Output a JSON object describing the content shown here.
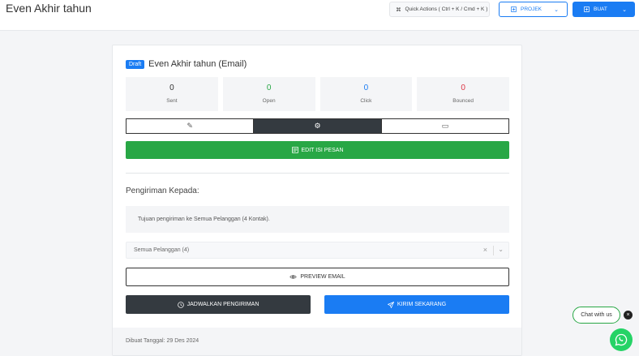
{
  "header": {
    "title": "Even Akhir tahun",
    "quick_actions_label": "Quick Actions ( Ctrl + K / Cmd + K )",
    "project_label": "PROJEK",
    "create_label": "BUAT"
  },
  "email": {
    "badge": "Draft",
    "title": "Even Akhir tahun (Email)"
  },
  "stats": [
    {
      "value": "0",
      "label": "Sent",
      "color": "#333333"
    },
    {
      "value": "0",
      "label": "Open",
      "color": "#28a745"
    },
    {
      "value": "0",
      "label": "Click",
      "color": "#1a7cf3"
    },
    {
      "value": "0",
      "label": "Bounced",
      "color": "#dc3545"
    }
  ],
  "tabs": [
    {
      "icon": "edit-icon",
      "glyph": "✎"
    },
    {
      "icon": "gear-icon",
      "glyph": "⚙"
    },
    {
      "icon": "window-icon",
      "glyph": "▭"
    }
  ],
  "actions": {
    "edit_label": "EDIT ISI PESAN",
    "preview_label": "PREVIEW EMAIL",
    "schedule_label": "JADWALKAN PENGIRIMAN",
    "send_label": "KIRIM SEKARANG"
  },
  "recipients": {
    "section_label": "Pengiriman Kepada:",
    "info": "Tujuan pengiriman ke Semua Pelanggan (4 Kontak).",
    "select_value": "Semua Pelanggan (4)"
  },
  "footer": {
    "created": "Dibuat Tanggal: 29 Des 2024"
  },
  "chat": {
    "label": "Chat with us",
    "close": "×"
  }
}
